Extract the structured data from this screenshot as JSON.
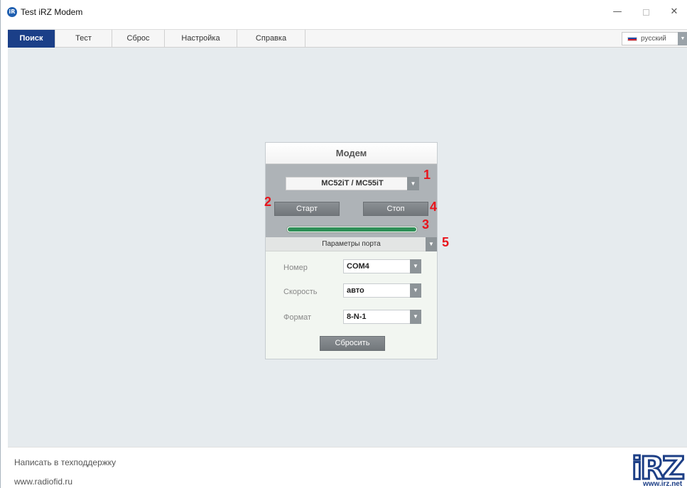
{
  "window": {
    "title": "Test iRZ Modem",
    "icon_letter": "iR",
    "minimize_glyph": "—",
    "close_glyph": "✕"
  },
  "menu": {
    "tabs": [
      "Поиск",
      "Тест",
      "Сброс",
      "Настройка",
      "Справка"
    ],
    "active_tab": "Поиск",
    "language": "русский"
  },
  "modem_panel": {
    "title": "Модем",
    "model": "MC52iT / MC55iT",
    "start_label": "Старт",
    "stop_label": "Стоп",
    "progress": 1.0,
    "port_params_label": "Параметры порта",
    "fields": [
      {
        "label": "Номер",
        "value": "COM4"
      },
      {
        "label": "Скорость",
        "value": "авто"
      },
      {
        "label": "Формат",
        "value": "8-N-1"
      }
    ],
    "reset_label": "Сбросить"
  },
  "markers": [
    "1",
    "2",
    "3",
    "4",
    "5"
  ],
  "footer": {
    "support_link": "Написать в техподдержку",
    "site_link": "www.radiofid.ru",
    "logo_text": "iRZ",
    "logo_url": "www.irz.net"
  },
  "colors": {
    "accent": "#1b3f88",
    "progress": "#2f8f57",
    "marker": "#e8141c",
    "background": "#e6ebee"
  },
  "icons": {
    "dropdown": "chevron-down-icon",
    "flag": "russian-flag-icon"
  }
}
